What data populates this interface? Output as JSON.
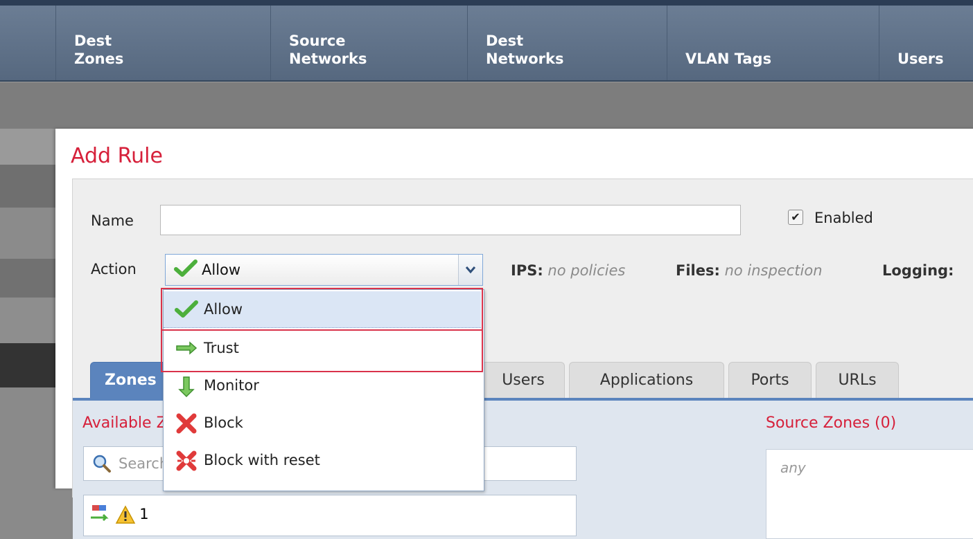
{
  "table_header": {
    "columns": [
      {
        "label": "Dest\nZones"
      },
      {
        "label": "Source\nNetworks"
      },
      {
        "label": "Dest\nNetworks"
      },
      {
        "label": "VLAN Tags"
      },
      {
        "label": "Users"
      }
    ]
  },
  "dialog": {
    "title": "Add Rule",
    "name_label": "Name",
    "name_value": "",
    "enabled_label": "Enabled",
    "enabled_checked": true,
    "action_label": "Action",
    "action_value": "Allow",
    "ips_label": "IPS:",
    "ips_value": "no policies",
    "files_label": "Files:",
    "files_value": "no inspection",
    "logging_label": "Logging:"
  },
  "tabs": [
    {
      "label": "Zones",
      "active": true
    },
    {
      "label": "Users"
    },
    {
      "label": "Applications"
    },
    {
      "label": "Ports"
    },
    {
      "label": "URLs"
    }
  ],
  "zones_panel": {
    "available_title": "Available Zones",
    "search_placeholder": "Search",
    "zone_item_prefix": "1",
    "source_title": "Source Zones (0)",
    "source_empty": "any"
  },
  "action_dropdown": {
    "options": [
      {
        "label": "Allow",
        "icon": "check-icon",
        "color": "#4caf3c"
      },
      {
        "label": "Trust",
        "icon": "arrow-right-icon",
        "color": "#4caf3c"
      },
      {
        "label": "Monitor",
        "icon": "arrow-down-icon",
        "color": "#4caf3c"
      },
      {
        "label": "Block",
        "icon": "x-icon",
        "color": "#e03a3a"
      },
      {
        "label": "Block with reset",
        "icon": "x-reset-icon",
        "color": "#e03a3a"
      }
    ],
    "highlighted": [
      "Allow",
      "Trust"
    ]
  },
  "colors": {
    "accent_red": "#d6203a",
    "tab_active": "#5b84bd",
    "header_bg": "#5f7188"
  }
}
